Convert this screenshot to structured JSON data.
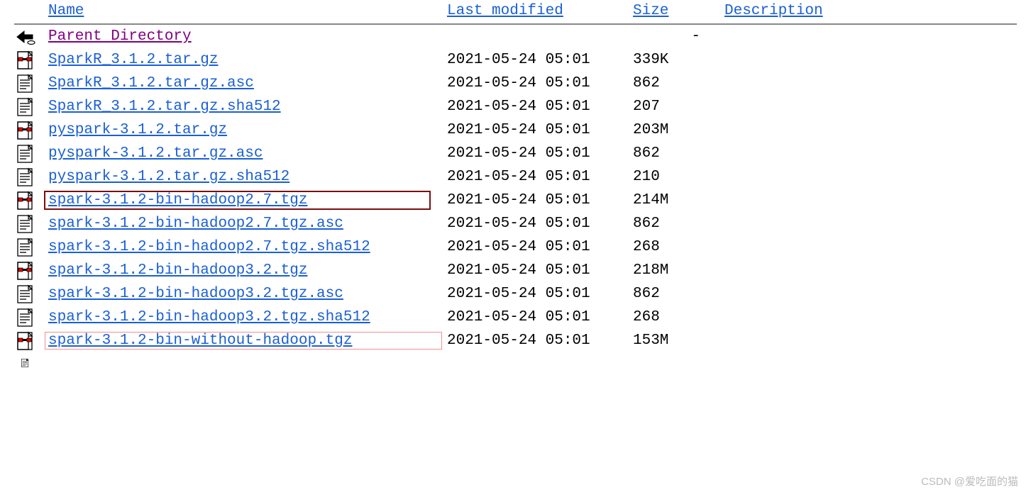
{
  "headers": {
    "name": "Name",
    "modified": "Last modified",
    "size": "Size",
    "description": "Description"
  },
  "parent_link": "Parent Directory",
  "rows": [
    {
      "icon": "archive",
      "name": "SparkR_3.1.2.tar.gz",
      "modified": "2021-05-24 05:01",
      "size": "339K",
      "highlight": "none"
    },
    {
      "icon": "text",
      "name": "SparkR_3.1.2.tar.gz.asc",
      "modified": "2021-05-24 05:01",
      "size": "862",
      "highlight": "none"
    },
    {
      "icon": "text",
      "name": "SparkR_3.1.2.tar.gz.sha512",
      "modified": "2021-05-24 05:01",
      "size": "207",
      "highlight": "none"
    },
    {
      "icon": "archive",
      "name": "pyspark-3.1.2.tar.gz",
      "modified": "2021-05-24 05:01",
      "size": "203M",
      "highlight": "none"
    },
    {
      "icon": "text",
      "name": "pyspark-3.1.2.tar.gz.asc",
      "modified": "2021-05-24 05:01",
      "size": "862",
      "highlight": "none"
    },
    {
      "icon": "text",
      "name": "pyspark-3.1.2.tar.gz.sha512",
      "modified": "2021-05-24 05:01",
      "size": "210",
      "highlight": "none"
    },
    {
      "icon": "archive",
      "name": "spark-3.1.2-bin-hadoop2.7.tgz",
      "modified": "2021-05-24 05:01",
      "size": "214M",
      "highlight": "dark"
    },
    {
      "icon": "text",
      "name": "spark-3.1.2-bin-hadoop2.7.tgz.asc",
      "modified": "2021-05-24 05:01",
      "size": "862",
      "highlight": "none"
    },
    {
      "icon": "text",
      "name": "spark-3.1.2-bin-hadoop2.7.tgz.sha512",
      "modified": "2021-05-24 05:01",
      "size": "268",
      "highlight": "none"
    },
    {
      "icon": "archive",
      "name": "spark-3.1.2-bin-hadoop3.2.tgz",
      "modified": "2021-05-24 05:01",
      "size": "218M",
      "highlight": "none"
    },
    {
      "icon": "text",
      "name": "spark-3.1.2-bin-hadoop3.2.tgz.asc",
      "modified": "2021-05-24 05:01",
      "size": "862",
      "highlight": "none"
    },
    {
      "icon": "text",
      "name": "spark-3.1.2-bin-hadoop3.2.tgz.sha512",
      "modified": "2021-05-24 05:01",
      "size": "268",
      "highlight": "none"
    },
    {
      "icon": "archive",
      "name": "spark-3.1.2-bin-without-hadoop.tgz",
      "modified": "2021-05-24 05:01",
      "size": "153M",
      "highlight": "light"
    }
  ],
  "watermark": "CSDN @爱吃面的猫"
}
